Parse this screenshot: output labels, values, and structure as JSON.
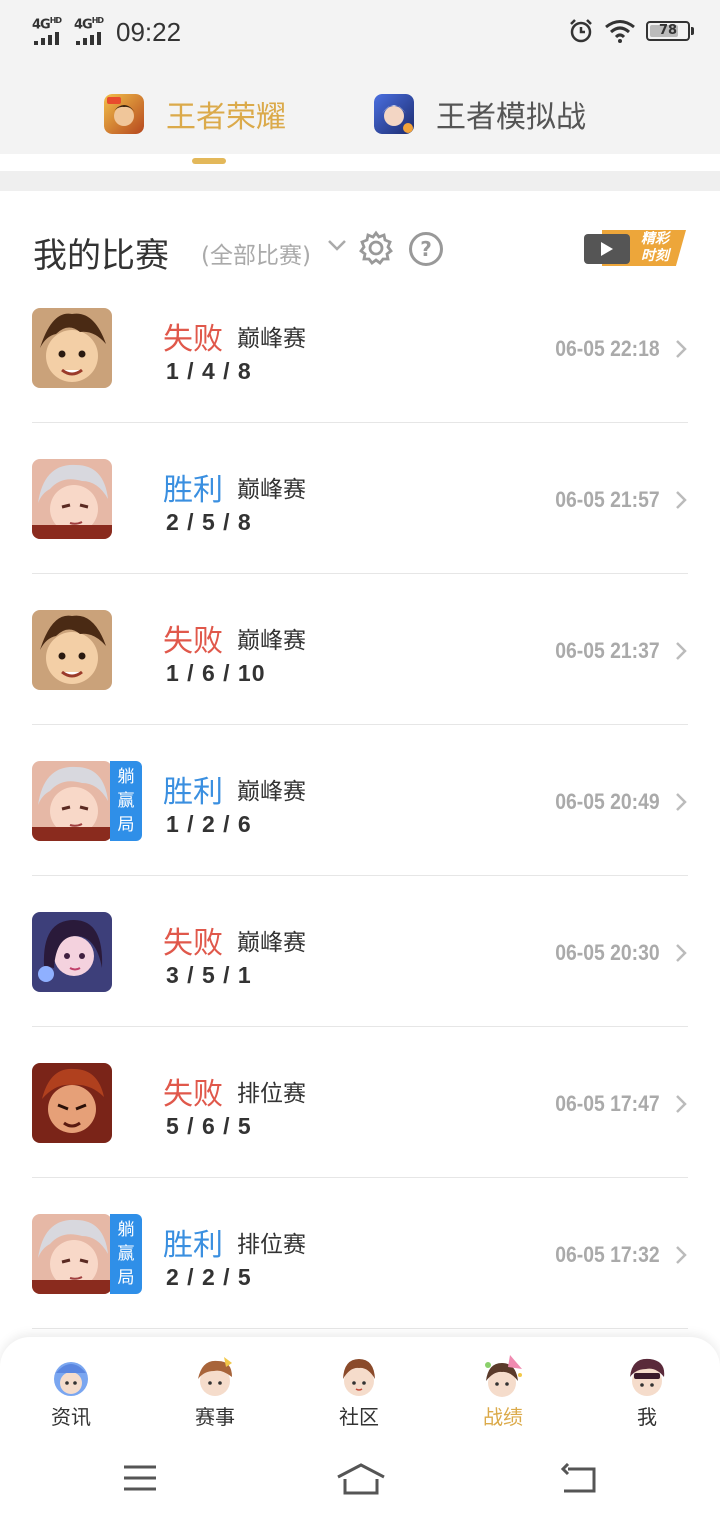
{
  "status_bar": {
    "signal1": "4G",
    "signal2": "4G",
    "signal_sup": "HD",
    "time": "09:22",
    "battery": "78",
    "battery_level": 0.78
  },
  "game_tabs": [
    {
      "label": "王者荣耀",
      "active": true
    },
    {
      "label": "王者模拟战",
      "active": false
    }
  ],
  "my_matches": {
    "title": "我的比赛",
    "filter_label": "(全部比赛)",
    "highlight_badge_line1": "精彩",
    "highlight_badge_line2": "时刻"
  },
  "lay_badge_lines": [
    "躺",
    "赢",
    "局"
  ],
  "matches": [
    {
      "result": "失败",
      "outcome": "lose",
      "mode": "巅峰赛",
      "kda": "1 / 4 / 8",
      "time": "06-05 22:18",
      "hero": "hero-a",
      "lay_win": false
    },
    {
      "result": "胜利",
      "outcome": "win",
      "mode": "巅峰赛",
      "kda": "2 / 5 / 8",
      "time": "06-05 21:57",
      "hero": "hero-b",
      "lay_win": false
    },
    {
      "result": "失败",
      "outcome": "lose",
      "mode": "巅峰赛",
      "kda": "1 / 6 / 10",
      "time": "06-05 21:37",
      "hero": "hero-a",
      "lay_win": false
    },
    {
      "result": "胜利",
      "outcome": "win",
      "mode": "巅峰赛",
      "kda": "1 / 2 / 6",
      "time": "06-05 20:49",
      "hero": "hero-b",
      "lay_win": true
    },
    {
      "result": "失败",
      "outcome": "lose",
      "mode": "巅峰赛",
      "kda": "3 / 5 / 1",
      "time": "06-05 20:30",
      "hero": "hero-c",
      "lay_win": false
    },
    {
      "result": "失败",
      "outcome": "lose",
      "mode": "排位赛",
      "kda": "5 / 6 / 5",
      "time": "06-05 17:47",
      "hero": "hero-d",
      "lay_win": false
    },
    {
      "result": "胜利",
      "outcome": "win",
      "mode": "排位赛",
      "kda": "2 / 2 / 5",
      "time": "06-05 17:32",
      "hero": "hero-b",
      "lay_win": true
    }
  ],
  "bottom_nav": [
    {
      "label": "资讯",
      "icon": "news-mascot-icon",
      "active": false
    },
    {
      "label": "赛事",
      "icon": "events-mascot-icon",
      "active": false
    },
    {
      "label": "社区",
      "icon": "community-mascot-icon",
      "active": false
    },
    {
      "label": "战绩",
      "icon": "record-mascot-icon",
      "active": true
    },
    {
      "label": "我",
      "icon": "me-mascot-icon",
      "active": false
    }
  ],
  "colors": {
    "accent_gold": "#dbaa4a",
    "lose_red": "#e0584b",
    "win_blue": "#3a8fe0",
    "lay_badge_blue": "#2f8fe8",
    "highlight_orange": "#eda63a"
  }
}
